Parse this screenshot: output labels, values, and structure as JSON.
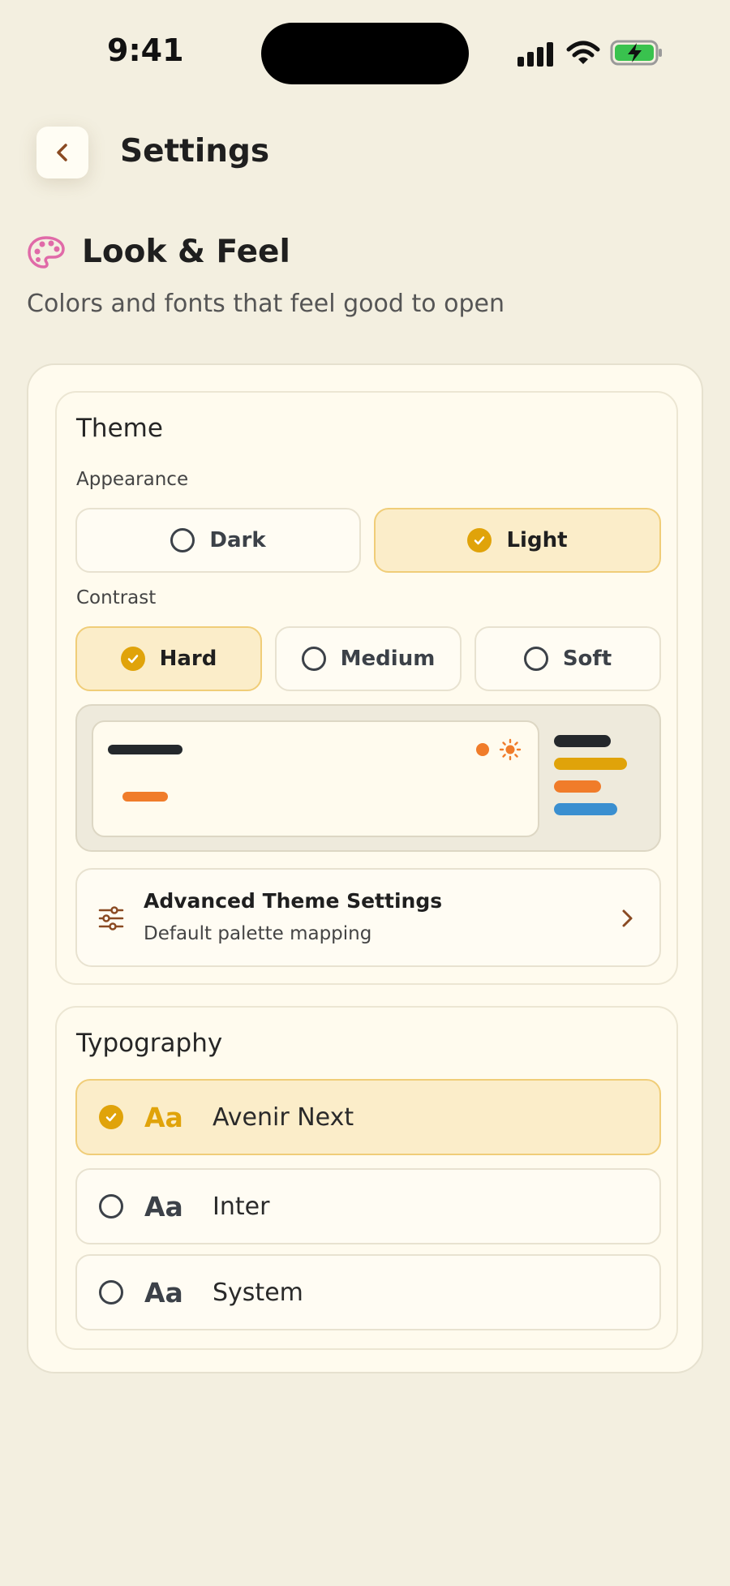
{
  "status_bar": {
    "time": "9:41"
  },
  "header": {
    "title": "Settings"
  },
  "section": {
    "title": "Look & Feel",
    "subtitle": "Colors and fonts that feel good to open"
  },
  "theme": {
    "title": "Theme",
    "appearance_label": "Appearance",
    "appearance_options": [
      {
        "label": "Dark",
        "selected": false
      },
      {
        "label": "Light",
        "selected": true
      }
    ],
    "contrast_label": "Contrast",
    "contrast_options": [
      {
        "label": "Hard",
        "selected": true
      },
      {
        "label": "Medium",
        "selected": false
      },
      {
        "label": "Soft",
        "selected": false
      }
    ],
    "preview_palette": [
      "#24282c",
      "#e0a30a",
      "#f07c2a",
      "#3a8fd0"
    ],
    "advanced": {
      "title": "Advanced Theme Settings",
      "subtitle": "Default palette mapping"
    }
  },
  "typography": {
    "title": "Typography",
    "sample": "Aa",
    "fonts": [
      {
        "name": "Avenir Next",
        "selected": true
      },
      {
        "name": "Inter",
        "selected": false
      },
      {
        "name": "System",
        "selected": false
      }
    ]
  },
  "colors": {
    "background": "#f3efe0",
    "card": "#fffbee",
    "accent": "#e0a30a",
    "selected_bg": "#fbedc9",
    "brown_icon": "#8a4a22",
    "palette_icon": "#e06aa8"
  }
}
